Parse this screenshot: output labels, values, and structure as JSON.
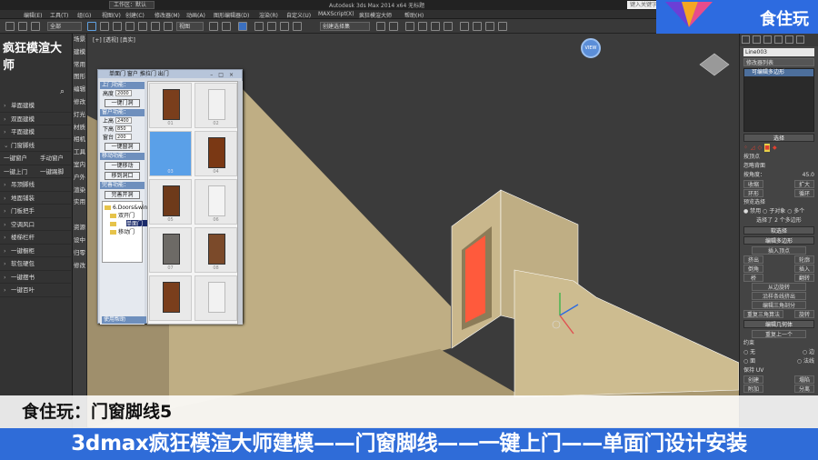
{
  "window": {
    "workspace": "工作区：默认",
    "app_title": "Autodesk 3ds Max 2014 x64    无标题",
    "search_placeholder": "键入关键字或短语"
  },
  "menu": [
    "编辑(E)",
    "工具(T)",
    "组(G)",
    "视图(V)",
    "创建(C)",
    "修改器(M)",
    "动画(A)",
    "图形编辑器(D)",
    "渲染(R)",
    "自定义(U)",
    "MAXScript(X)",
    "疯狂模渲大师",
    "帮助(H)"
  ],
  "toolbar": {
    "filter": "全部",
    "view": "视图",
    "selection_set": "创建选择集"
  },
  "plugin": {
    "title": "疯狂模渲大师",
    "search_icon": "⌕",
    "menu_items": [
      {
        "label": "单面建模",
        "side": "场景",
        "type": "arrow"
      },
      {
        "label": "双面建模",
        "side": "建模",
        "type": "arrow"
      },
      {
        "label": "平面建模",
        "side": "常用",
        "type": "arrow"
      },
      {
        "label": "门窗脚线",
        "side": "图形",
        "type": "open"
      },
      {
        "label": "一键窗户",
        "label2": "手动窗户",
        "side": "编辑",
        "type": "pair"
      },
      {
        "label": "一键上门",
        "label2": "一键踢脚",
        "side": "修改",
        "type": "pair"
      },
      {
        "label": "吊顶脚线",
        "side": "灯光",
        "type": "arrow"
      },
      {
        "label": "地面铺装",
        "side": "材质",
        "type": "arrow"
      },
      {
        "label": "门板把手",
        "side": "相机",
        "type": "arrow"
      },
      {
        "label": "空调风口",
        "side": "工具",
        "type": "arrow"
      },
      {
        "label": "楼梯栏杆",
        "side": "室内",
        "type": "arrow"
      },
      {
        "label": "一键橱柜",
        "side": "户外",
        "type": "arrow"
      },
      {
        "label": "软包硬包",
        "side": "渲染",
        "type": "arrow"
      },
      {
        "label": "一键摆书",
        "side": "实用",
        "type": "arrow"
      },
      {
        "label": "一键百叶",
        "side": "",
        "type": "arrow"
      }
    ],
    "extra_strip": [
      "资源",
      "设中",
      "归零",
      "修改"
    ]
  },
  "door_window": {
    "title": "单面门   窗户   推拉门   出门",
    "sections": {
      "door": "上门功能：",
      "window": "窗户功能：",
      "move": "移动功能：",
      "restore": "完善功能："
    },
    "fields": {
      "height_label": "高度",
      "height_val": "2000",
      "top_label": "上高",
      "top_val": "2400",
      "bottom_label": "下高",
      "bottom_val": "850",
      "sill_label": "窗台",
      "sill_val": "200"
    },
    "buttons": {
      "one_door": "一键门洞",
      "one_window": "一键窗洞",
      "one_move": "一键移动",
      "fix": "移到洞口",
      "complete": "完善开洞"
    },
    "tree": {
      "root": "6.Doors&win",
      "f1": "双开门",
      "f2": "单面门",
      "f3": "移动门"
    },
    "thumb_labels": [
      "01",
      "02",
      "03",
      "04",
      "05",
      "06",
      "07",
      "08"
    ],
    "footer": "使用帮助"
  },
  "viewport": {
    "label": "[+] [透视] [真实]",
    "gizmo_label": "VIEW"
  },
  "command_panel": {
    "object_name": "Line003",
    "modifier_list": "修改器列表",
    "stack_item": "可编辑多边形",
    "selection_title": "选择",
    "opt_by_vertex": "按顶点",
    "opt_ignore_back": "忽略背面",
    "opt_by_angle": "按角度：",
    "angle_val": "45.0",
    "btn_shrink": "收缩",
    "btn_grow": "扩大",
    "btn_ring": "环形",
    "btn_loop": "循环",
    "preview_title": "预览选择",
    "preview_opts": "● 禁用  ○ 子对象  ○ 多个",
    "selected_info": "选择了 2 个多边形",
    "soft_sel": "软选择",
    "edit_poly": "编辑多边形",
    "insert_vertex": "插入顶点",
    "b_extrude": "挤出",
    "b_outline": "轮廓",
    "b_bevel": "倒角",
    "b_inset": "插入",
    "b_bridge": "桥",
    "b_flip": "翻转",
    "b_hinge": "从边旋转",
    "b_extrude_spline": "沿样条线挤出",
    "b_edit_tri": "编辑三角剖分",
    "b_retri": "重复三角算法",
    "b_turn": "旋转",
    "geom_title": "编辑几何体",
    "repeat_last": "重复上一个",
    "constraint": "约束",
    "c_none": "○ 无",
    "c_edge": "○ 边",
    "c_face": "○ 面",
    "c_normal": "○ 法线",
    "keep_uv": "保持 UV",
    "b_create": "创建",
    "b_collapse": "塌陷",
    "b_attach": "附加",
    "b_detach": "分离"
  },
  "brand": {
    "name": "食住玩"
  },
  "captions": {
    "top": "食住玩：门窗脚线5",
    "bottom": "3dmax疯狂模渲大师建模——门窗脚线——一键上门——单面门设计安装"
  }
}
